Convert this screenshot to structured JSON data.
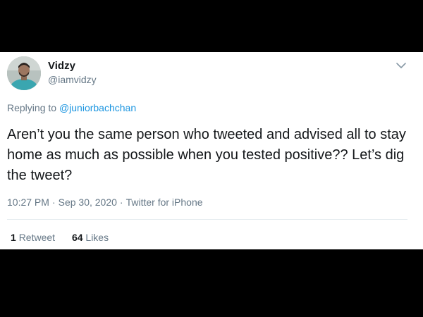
{
  "tweet": {
    "author": {
      "display_name": "Vidzy",
      "handle": "@iamvidzy",
      "avatar": "avatar"
    },
    "menu_icon": "chevron-down-icon",
    "reply": {
      "prefix": "Replying to",
      "mention": "@juniorbachchan"
    },
    "text": "Aren’t you the same person who tweeted and advised all to stay home as much as possible when you tested positive?? Let’s dig the tweet?",
    "meta": {
      "time": "10:27 PM",
      "separator": "·",
      "date": "Sep 30, 2020",
      "source": "Twitter for iPhone"
    },
    "stats": {
      "retweets_count": "1",
      "retweets_label": "Retweet",
      "likes_count": "64",
      "likes_label": "Likes"
    }
  },
  "colors": {
    "background": "#000000",
    "card": "#ffffff",
    "text_primary": "#14171a",
    "text_secondary": "#657786",
    "link": "#1b95e0",
    "divider": "#e6ecf0"
  }
}
